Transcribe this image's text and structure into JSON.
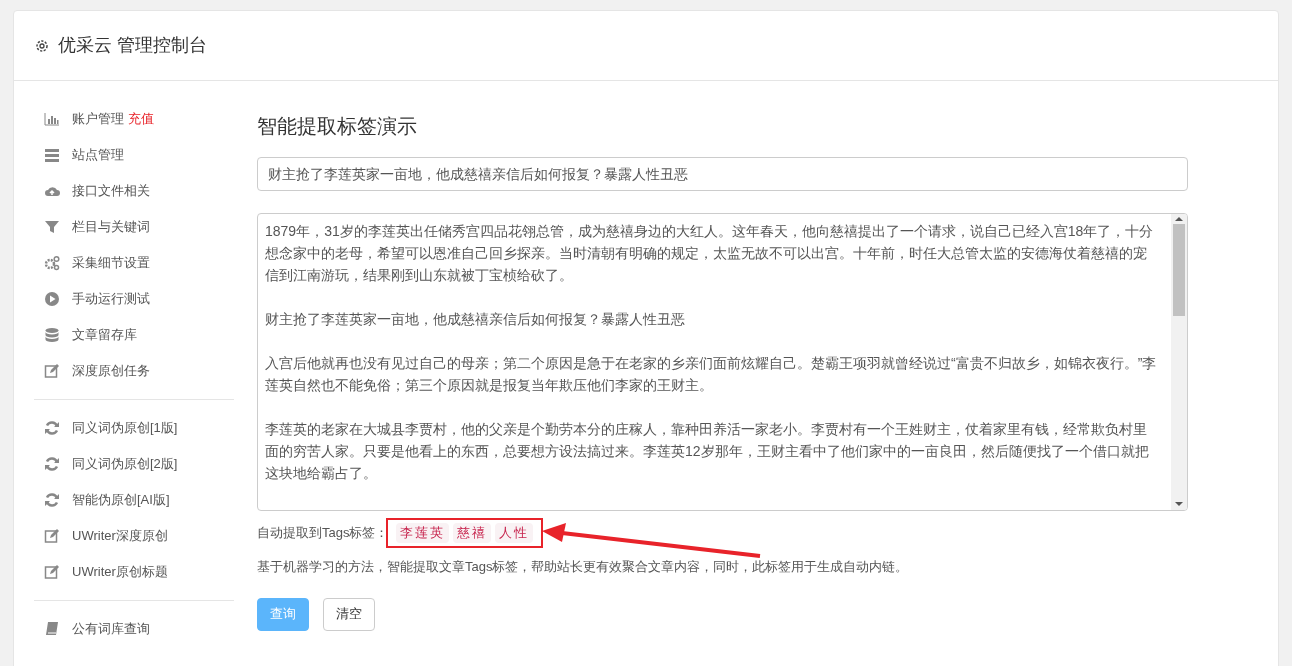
{
  "header": {
    "title": "优采云 管理控制台"
  },
  "sidebar": {
    "groups": [
      {
        "items": [
          {
            "kind": "bar-chart",
            "label": "账户管理",
            "badge": "充值"
          },
          {
            "kind": "server",
            "label": "站点管理"
          },
          {
            "kind": "cloud-upload",
            "label": "接口文件相关"
          },
          {
            "kind": "filter",
            "label": "栏目与关键词"
          },
          {
            "kind": "gears",
            "label": "采集细节设置"
          },
          {
            "kind": "play",
            "label": "手动运行测试"
          },
          {
            "kind": "database",
            "label": "文章留存库"
          },
          {
            "kind": "edit",
            "label": "深度原创任务"
          }
        ]
      },
      {
        "items": [
          {
            "kind": "refresh",
            "label": "同义词伪原创[1版]"
          },
          {
            "kind": "refresh",
            "label": "同义词伪原创[2版]"
          },
          {
            "kind": "refresh",
            "label": "智能伪原创[AI版]"
          },
          {
            "kind": "edit",
            "label": "UWriter深度原创"
          },
          {
            "kind": "edit",
            "label": "UWriter原创标题"
          }
        ]
      },
      {
        "items": [
          {
            "kind": "book",
            "label": "公有词库查询"
          }
        ]
      }
    ]
  },
  "main": {
    "heading": "智能提取标签演示",
    "title_field": {
      "value": "财主抢了李莲英家一亩地，他成慈禧亲信后如何报复？暴露人性丑恶"
    },
    "content_field": {
      "paragraphs": [
        "1879年，31岁的李莲英出任储秀宫四品花翎总管，成为慈禧身边的大红人。这年春天，他向慈禧提出了一个请求，说自己已经入宫18年了，十分想念家中的老母，希望可以恩准自己回乡探亲。当时清朝有明确的规定，太监无故不可以出宫。十年前，时任大总管太监的安德海仗着慈禧的宠信到江南游玩，结果刚到山东就被丁宝桢给砍了。",
        "财主抢了李莲英家一亩地，他成慈禧亲信后如何报复？暴露人性丑恶",
        "入宫后他就再也没有见过自己的母亲；第二个原因是急于在老家的乡亲们面前炫耀自己。楚霸王项羽就曾经说过“富贵不归故乡，如锦衣夜行。”李莲英自然也不能免俗；第三个原因就是报复当年欺压他们李家的王财主。",
        "李莲英的老家在大城县李贾村，他的父亲是个勤劳本分的庄稼人，靠种田养活一家老小。李贾村有一个王姓财主，仗着家里有钱，经常欺负村里面的穷苦人家。只要是他看上的东西，总要想方设法搞过来。李莲英12岁那年，王财主看中了他们家中的一亩良田，然后随便找了一个借口就把这块地给霸占了。"
      ]
    },
    "tags_label": "自动提取到Tags标签：",
    "tags": [
      "李莲英",
      "慈禧",
      "人性"
    ],
    "description": "基于机器学习的方法，智能提取文章Tags标签，帮助站长更有效聚合文章内容，同时，此标签用于生成自动内链。",
    "buttons": [
      {
        "label": "查询",
        "kind": "primary"
      },
      {
        "label": "清空",
        "kind": "default"
      }
    ]
  }
}
